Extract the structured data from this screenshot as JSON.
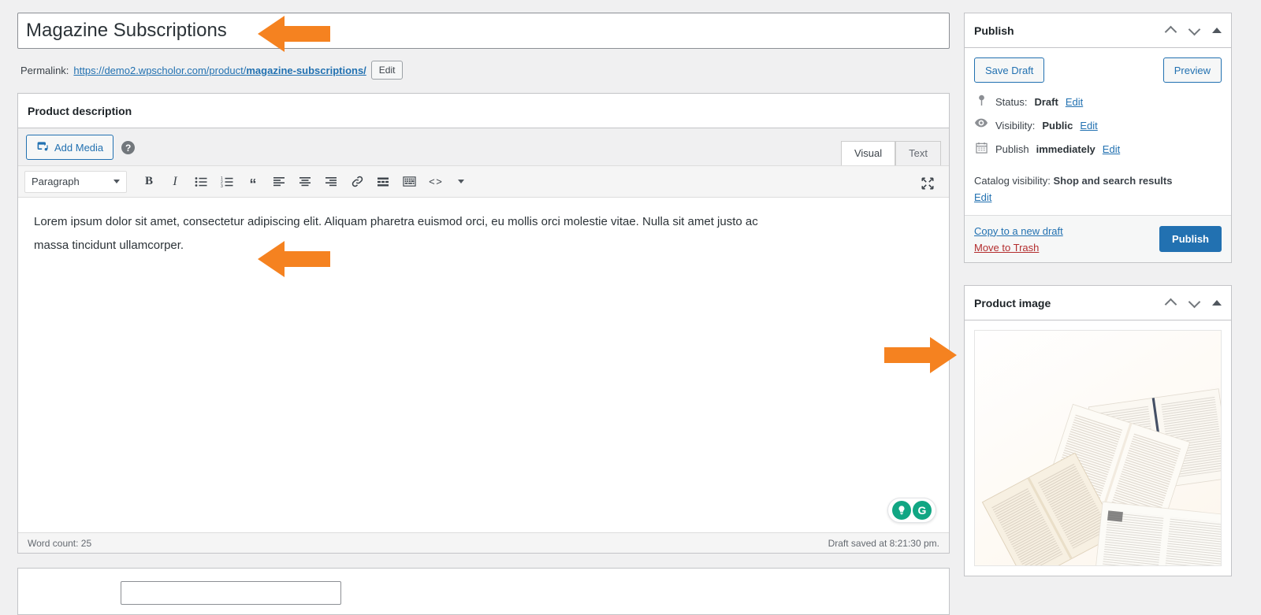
{
  "accent_color": "#2271b1",
  "annotation_color": "#F58220",
  "post": {
    "title": "Magazine Subscriptions",
    "permalink_label": "Permalink:",
    "permalink_base": "https://demo2.wpscholor.com/product/",
    "permalink_slug": "magazine-subscriptions/",
    "permalink_edit_label": "Edit"
  },
  "description_panel": {
    "title": "Product description",
    "add_media_label": "Add Media",
    "help_icon": "help-icon",
    "tabs": [
      {
        "label": "Visual",
        "active": true
      },
      {
        "label": "Text",
        "active": false
      }
    ],
    "format_select": "Paragraph",
    "toolbar_buttons": [
      "bold-icon",
      "italic-icon",
      "bulleted-list-icon",
      "numbered-list-icon",
      "blockquote-icon",
      "align-left-icon",
      "align-center-icon",
      "align-right-icon",
      "link-icon",
      "read-more-icon",
      "keyboard-shortcuts-icon",
      "code-icon",
      "toolbar-toggle-icon"
    ],
    "fullscreen_icon": "fullscreen-icon",
    "content_line1": "Lorem ipsum dolor sit amet, consectetur adipiscing elit. Aliquam pharetra euismod orci, eu mollis orci molestie vitae. Nulla sit amet justo ac",
    "content_line2": "massa tincidunt ullamcorper.",
    "grammarly": {
      "assistant_icon": "lightbulb-icon",
      "brand_icon": "grammarly-g-icon"
    },
    "status": {
      "word_count": "Word count: 25",
      "saved": "Draft saved at 8:21:30 pm."
    }
  },
  "publish_panel": {
    "title": "Publish",
    "save_draft_label": "Save Draft",
    "preview_label": "Preview",
    "status_label": "Status:",
    "status_value": "Draft",
    "status_edit": "Edit",
    "visibility_label": "Visibility:",
    "visibility_value": "Public",
    "visibility_edit": "Edit",
    "publish_time_label": "Publish",
    "publish_time_value": "immediately",
    "publish_time_edit": "Edit",
    "catalog_label": "Catalog visibility:",
    "catalog_value": "Shop and search results",
    "catalog_edit": "Edit",
    "copy_draft_label": "Copy to a new draft",
    "trash_label": "Move to Trash",
    "publish_button_label": "Publish",
    "icons": {
      "status": "pin-icon",
      "visibility": "eye-icon",
      "schedule": "calendar-icon",
      "collapse_up": "chevron-up-icon",
      "collapse_down": "chevron-down-icon",
      "toggle": "toggle-triangle-icon"
    }
  },
  "product_image_panel": {
    "title": "Product image",
    "image_alt": "open books and magazines on white background",
    "icons": {
      "collapse_up": "chevron-up-icon",
      "collapse_down": "chevron-down-icon",
      "toggle": "toggle-triangle-icon"
    }
  },
  "annotations": [
    {
      "name": "arrow-pointing-to-title",
      "direction": "left"
    },
    {
      "name": "arrow-pointing-to-description-text",
      "direction": "left"
    },
    {
      "name": "arrow-pointing-to-product-image",
      "direction": "right"
    }
  ]
}
